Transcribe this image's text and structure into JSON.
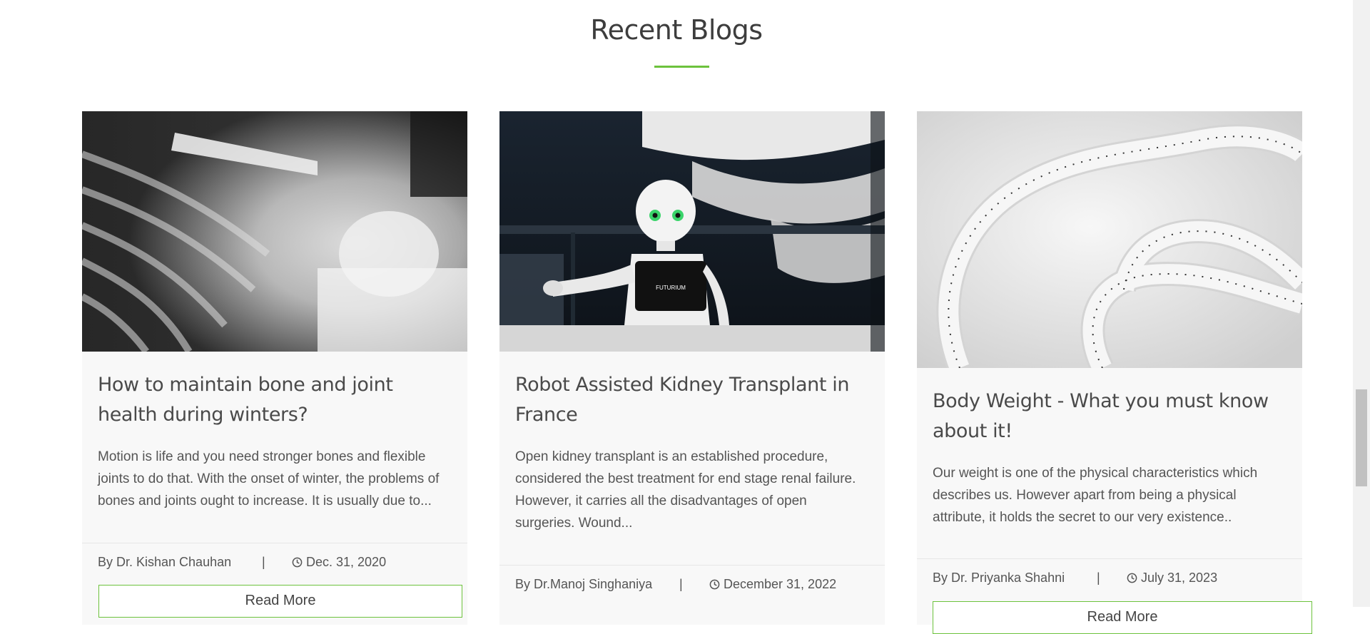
{
  "section": {
    "title": "Recent Blogs"
  },
  "colors": {
    "accent": "#6cc23c",
    "card_background": "#f8f8f8",
    "title_text": "#4a4a4a",
    "body_text": "#555555"
  },
  "posts": [
    {
      "image": "x-ray-shoulder-image",
      "title": "How to maintain bone and joint health during winters?",
      "excerpt": "Motion is life and you need stronger bones and flexible joints to do that. With the onset of winter, the problems of bones and joints ought to increase. It is usually due to...",
      "author": "By Dr. Kishan Chauhan",
      "separator": "|",
      "date_icon": "clock-icon",
      "date": "Dec. 31, 2020",
      "cta": "Read More"
    },
    {
      "image": "robot-image",
      "title": "Robot Assisted Kidney Transplant in France",
      "excerpt": "Open kidney transplant is an established procedure, considered the best treatment for end stage renal failure. However, it carries all the disadvantages of open surgeries. Wound...",
      "author": "By Dr.Manoj Singhaniya",
      "separator": "|",
      "date_icon": "clock-icon",
      "date": "December 31, 2022",
      "robot_chest_text": "FUTURIUM",
      "cta": "Read More"
    },
    {
      "image": "measuring-tape-image",
      "title": "Body Weight - What you must know about it!",
      "excerpt": "Our weight is one of the physical characteristics which describes us. However apart from being a physical attribute, it holds the secret to our very existence..",
      "author": "By Dr. Priyanka Shahni",
      "separator": "|",
      "date_icon": "clock-icon",
      "date": "July 31, 2023",
      "cta": "Read More"
    }
  ]
}
